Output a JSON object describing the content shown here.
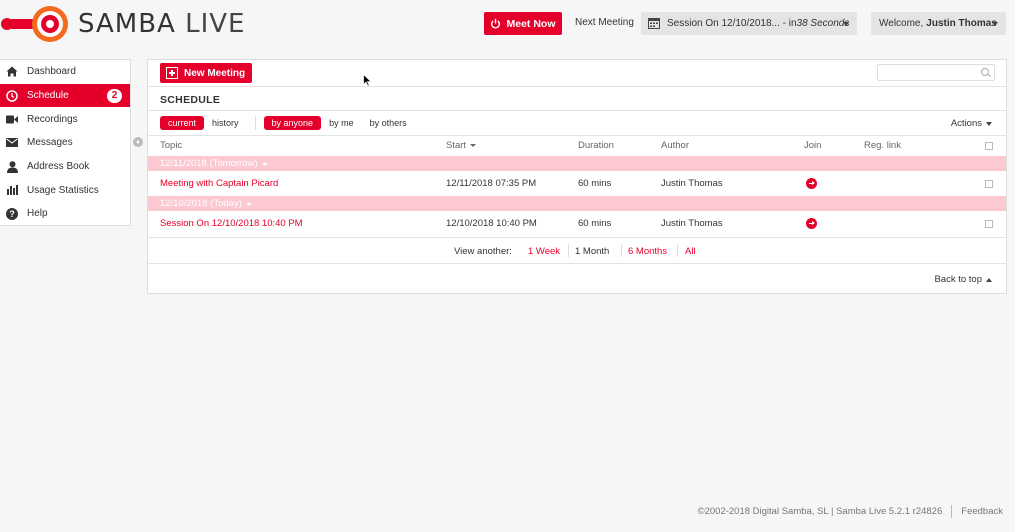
{
  "brand": {
    "name": "SAMBA",
    "suffix": "LIVE",
    "accent": "#e5002b"
  },
  "header": {
    "meet_now": "Meet Now",
    "next_meeting_label": "Next Meeting",
    "next_meeting_title": "Session On 12/10/2018... - in ",
    "next_meeting_countdown": "38 Seconds",
    "welcome_prefix": "Welcome,",
    "user_name": "Justin Thomas"
  },
  "sidebar": {
    "items": [
      {
        "label": "Dashboard",
        "icon": "home-icon"
      },
      {
        "label": "Schedule",
        "icon": "clock-icon",
        "active": true,
        "badge": "2"
      },
      {
        "label": "Recordings",
        "icon": "video-icon"
      },
      {
        "label": "Messages",
        "icon": "envelope-icon"
      },
      {
        "label": "Address Book",
        "icon": "person-icon"
      },
      {
        "label": "Usage Statistics",
        "icon": "bar-chart-icon"
      },
      {
        "label": "Help",
        "icon": "question-icon"
      }
    ]
  },
  "main": {
    "new_meeting": "New Meeting",
    "search_placeholder": "",
    "title": "SCHEDULE",
    "time_filters": [
      "current",
      "history"
    ],
    "owner_filters": [
      "by anyone",
      "by me",
      "by others"
    ],
    "actions": "Actions",
    "columns": {
      "topic": "Topic",
      "start": "Start",
      "duration": "Duration",
      "author": "Author",
      "join": "Join",
      "reg_link": "Reg. link"
    },
    "groups": [
      {
        "label": "12/11/2018 (Tomorrow)",
        "rows": [
          {
            "topic": "Meeting with Captain Picard",
            "start": "12/11/2018 07:35 PM",
            "duration": "60 mins",
            "author": "Justin Thomas"
          }
        ]
      },
      {
        "label": "12/10/2018 (Today)",
        "rows": [
          {
            "topic": "Session On 12/10/2018 10:40 PM",
            "start": "12/10/2018 10:40 PM",
            "duration": "60 mins",
            "author": "Justin Thomas"
          }
        ]
      }
    ],
    "view_another": {
      "label": "View another:",
      "options": [
        "1 Week",
        "1 Month",
        "6 Months",
        "All"
      ],
      "selected": "1 Month"
    },
    "back_to_top": "Back to top"
  },
  "footer": {
    "copyright": "©2002-2018 Digital Samba, SL | Samba Live 5.2.1 r24826",
    "feedback": "Feedback"
  }
}
